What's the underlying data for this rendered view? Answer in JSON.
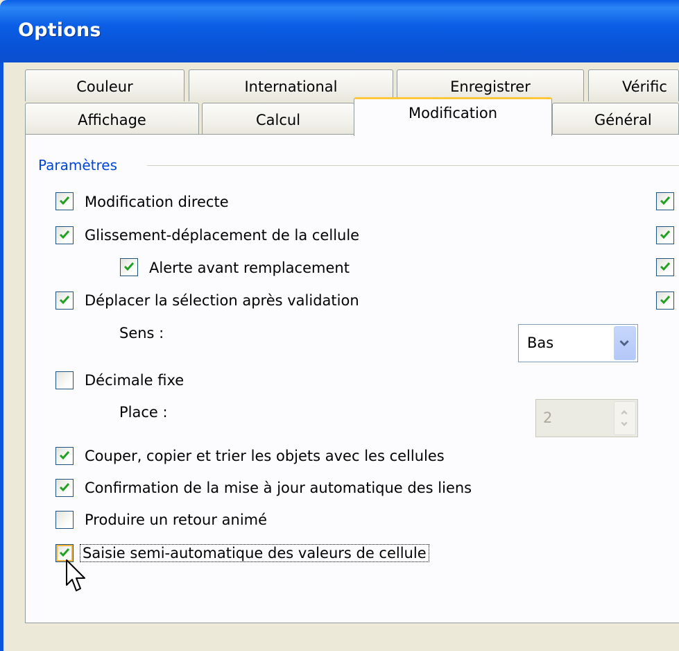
{
  "window": {
    "title": "Options"
  },
  "tabs": {
    "row1": [
      {
        "label": "Couleur"
      },
      {
        "label": "International"
      },
      {
        "label": "Enregistrer"
      },
      {
        "label": "Vérific"
      }
    ],
    "row2": [
      {
        "label": "Affichage"
      },
      {
        "label": "Calcul"
      },
      {
        "label": "Modification",
        "active": true
      },
      {
        "label": "Général"
      }
    ]
  },
  "group": {
    "title": "Paramètres"
  },
  "options": [
    {
      "label": "Modification directe",
      "checked": true
    },
    {
      "label": "Glissement-déplacement de la cellule",
      "checked": true
    },
    {
      "label": "Alerte avant remplacement",
      "checked": true
    },
    {
      "label": "Déplacer la sélection après validation",
      "checked": true
    },
    {
      "label": "Décimale fixe",
      "checked": false
    },
    {
      "label": "Couper, copier et trier les objets avec les cellules",
      "checked": true
    },
    {
      "label": "Confirmation de la mise à jour automatique des liens",
      "checked": true
    },
    {
      "label": "Produire un retour animé",
      "checked": false
    },
    {
      "label": "Saisie semi-automatique des valeurs de cellule",
      "checked": true
    }
  ],
  "sens": {
    "label": "Sens :",
    "value": "Bas"
  },
  "place": {
    "label": "Place :",
    "value": "2"
  },
  "right_checkboxes": [
    {
      "checked": true
    },
    {
      "checked": true
    },
    {
      "checked": true
    },
    {
      "checked": true
    }
  ],
  "colors": {
    "titlebar": "#0a5ee8",
    "group_title": "#0046d5",
    "check": "#21a121",
    "active_tab_accent": "#ffc83c"
  }
}
